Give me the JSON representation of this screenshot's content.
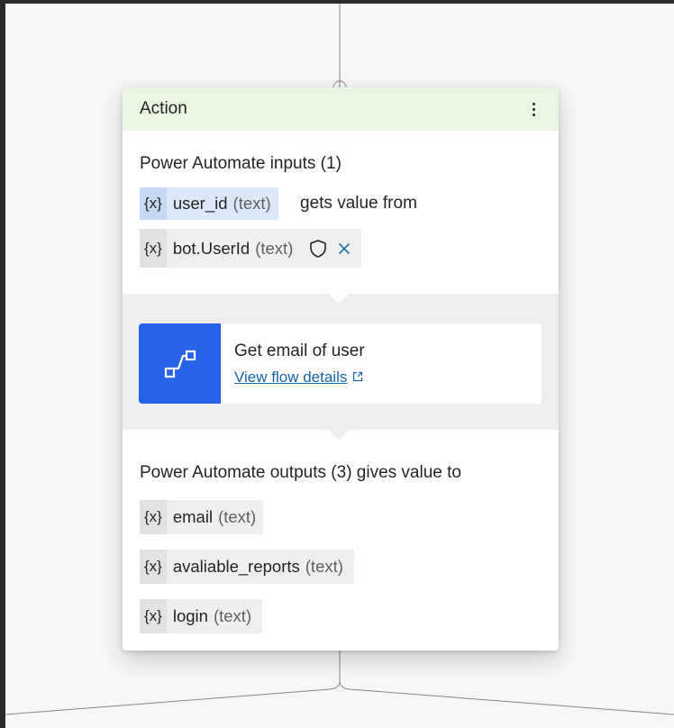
{
  "node": {
    "title": "Action",
    "inputs_label": "Power Automate inputs (1)",
    "input_param": {
      "glyph": "{x}",
      "name": "user_id",
      "type": "(text)"
    },
    "gets_value_text": "gets value from",
    "input_source": {
      "glyph": "{x}",
      "name": "bot.UserId",
      "type": "(text)"
    },
    "flow": {
      "name": "Get email of user",
      "link_text": "View flow details",
      "icon": "flow-connector-icon"
    },
    "outputs_label": "Power Automate outputs (3) gives value to",
    "outputs": [
      {
        "glyph": "{x}",
        "name": "email",
        "type": "(text)"
      },
      {
        "glyph": "{x}",
        "name": "avaliable_reports",
        "type": "(text)"
      },
      {
        "glyph": "{x}",
        "name": "login",
        "type": "(text)"
      }
    ]
  },
  "icons": {
    "more": "more-vertical-icon",
    "shield": "shield-icon",
    "remove": "close-icon",
    "external": "open-external-icon"
  },
  "colors": {
    "header_bg": "#eaf5e2",
    "flow_icon_bg": "#2763e8",
    "link": "#1764a8",
    "input_chip_bg": "#dbe8f9",
    "remove_icon": "#1f6fa8"
  }
}
